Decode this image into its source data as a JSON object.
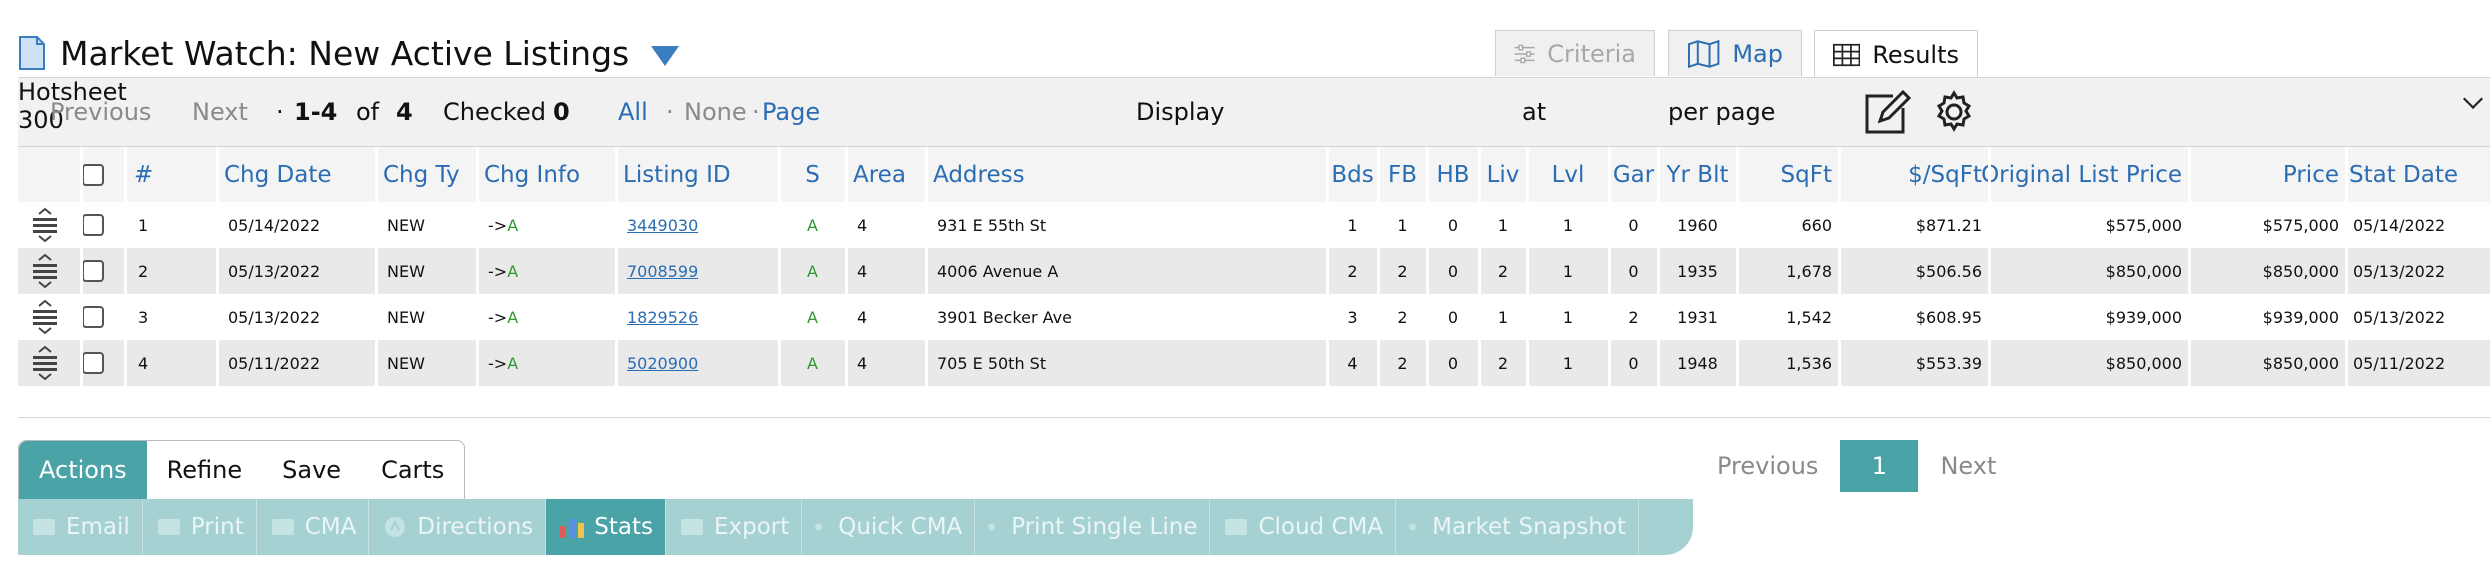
{
  "title": "Market Watch: New Active Listings",
  "view_tabs": {
    "criteria": "Criteria",
    "map": "Map",
    "results": "Results"
  },
  "toolbar": {
    "previous": "Previous",
    "next": "Next",
    "range_prefix": "·",
    "range": "1-4",
    "of": "of",
    "total": "4",
    "checked_label": "Checked",
    "checked_count": "0",
    "all": "All",
    "dot1": "·",
    "none": "None",
    "dot2": "·",
    "page": "Page",
    "display_label": "Display",
    "display_value": "Hotsheet",
    "at_label": "at",
    "per_page_value": "300",
    "per_page_label": "per page"
  },
  "columns": [
    "#",
    "Chg Date",
    "Chg Ty",
    "Chg Info",
    "Listing ID",
    "S",
    "Area",
    "Address",
    "Bds",
    "FB",
    "HB",
    "Liv",
    "Lvl",
    "Gar",
    "Yr Blt",
    "SqFt",
    "$/SqFt",
    "Original List Price",
    "Price",
    "Stat Date"
  ],
  "rows": [
    {
      "num": "1",
      "chg_date": "05/14/2022",
      "chg_ty": "NEW",
      "chg_arrow": "->",
      "chg_status": "A",
      "listing_id": "3449030",
      "s": "A",
      "area": "4",
      "address": "931 E 55th St",
      "bds": "1",
      "fb": "1",
      "hb": "0",
      "liv": "1",
      "lvl": "1",
      "gar": "0",
      "yr_blt": "1960",
      "sqft": "660",
      "per_sqft": "$871.21",
      "orig_price": "$575,000",
      "price": "$575,000",
      "stat_date": "05/14/2022"
    },
    {
      "num": "2",
      "chg_date": "05/13/2022",
      "chg_ty": "NEW",
      "chg_arrow": "->",
      "chg_status": "A",
      "listing_id": "7008599",
      "s": "A",
      "area": "4",
      "address": "4006 Avenue A",
      "bds": "2",
      "fb": "2",
      "hb": "0",
      "liv": "2",
      "lvl": "1",
      "gar": "0",
      "yr_blt": "1935",
      "sqft": "1,678",
      "per_sqft": "$506.56",
      "orig_price": "$850,000",
      "price": "$850,000",
      "stat_date": "05/13/2022"
    },
    {
      "num": "3",
      "chg_date": "05/13/2022",
      "chg_ty": "NEW",
      "chg_arrow": "->",
      "chg_status": "A",
      "listing_id": "1829526",
      "s": "A",
      "area": "4",
      "address": "3901 Becker Ave",
      "bds": "3",
      "fb": "2",
      "hb": "0",
      "liv": "1",
      "lvl": "1",
      "gar": "2",
      "yr_blt": "1931",
      "sqft": "1,542",
      "per_sqft": "$608.95",
      "orig_price": "$939,000",
      "price": "$939,000",
      "stat_date": "05/13/2022"
    },
    {
      "num": "4",
      "chg_date": "05/11/2022",
      "chg_ty": "NEW",
      "chg_arrow": "->",
      "chg_status": "A",
      "listing_id": "5020900",
      "s": "A",
      "area": "4",
      "address": "705 E 50th St",
      "bds": "4",
      "fb": "2",
      "hb": "0",
      "liv": "2",
      "lvl": "1",
      "gar": "0",
      "yr_blt": "1948",
      "sqft": "1,536",
      "per_sqft": "$553.39",
      "orig_price": "$850,000",
      "price": "$850,000",
      "stat_date": "05/11/2022"
    }
  ],
  "bottom_tabs": [
    "Actions",
    "Refine",
    "Save",
    "Carts"
  ],
  "pager": {
    "previous": "Previous",
    "current": "1",
    "next": "Next"
  },
  "actions": [
    "Email",
    "Print",
    "CMA",
    "Directions",
    "Stats",
    "Export",
    "Quick CMA",
    "Print Single Line",
    "Cloud CMA",
    "Market Snapshot"
  ],
  "colors": {
    "accent": "#4aa3a6",
    "link": "#2a6db3",
    "status_active": "#2e9a2e",
    "action_bar": "#a6d1d3"
  }
}
